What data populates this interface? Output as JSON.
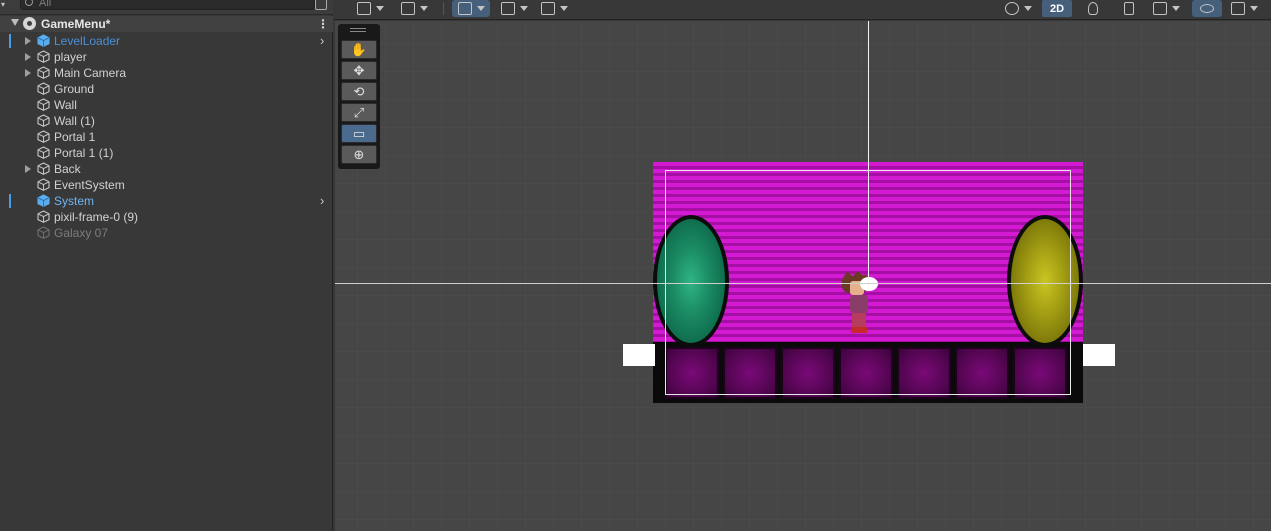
{
  "hierarchy": {
    "search_placeholder": "All",
    "scene_name": "GameMenu*",
    "items": [
      {
        "label": "LevelLoader",
        "color": "#4d8fd6",
        "expandable": true,
        "marker": true,
        "chevron": true,
        "icon": "cube-icon-blue"
      },
      {
        "label": "player",
        "color": "#d2d2d2",
        "expandable": true,
        "marker": false,
        "chevron": false,
        "icon": "cube-icon"
      },
      {
        "label": "Main Camera",
        "color": "#d2d2d2",
        "expandable": true,
        "marker": false,
        "chevron": false,
        "icon": "cube-icon"
      },
      {
        "label": "Ground",
        "color": "#d2d2d2",
        "expandable": false,
        "marker": false,
        "chevron": false,
        "icon": "cube-icon"
      },
      {
        "label": "Wall",
        "color": "#d2d2d2",
        "expandable": false,
        "marker": false,
        "chevron": false,
        "icon": "cube-icon"
      },
      {
        "label": "Wall (1)",
        "color": "#d2d2d2",
        "expandable": false,
        "marker": false,
        "chevron": false,
        "icon": "cube-icon"
      },
      {
        "label": "Portal 1",
        "color": "#d2d2d2",
        "expandable": false,
        "marker": false,
        "chevron": false,
        "icon": "cube-icon"
      },
      {
        "label": "Portal 1 (1)",
        "color": "#d2d2d2",
        "expandable": false,
        "marker": false,
        "chevron": false,
        "icon": "cube-icon"
      },
      {
        "label": "Back",
        "color": "#d2d2d2",
        "expandable": true,
        "marker": false,
        "chevron": false,
        "icon": "cube-icon"
      },
      {
        "label": "EventSystem",
        "color": "#d2d2d2",
        "expandable": false,
        "marker": false,
        "chevron": false,
        "icon": "cube-icon"
      },
      {
        "label": "System",
        "color": "#6fb4f2",
        "expandable": false,
        "marker": true,
        "chevron": true,
        "icon": "cube-icon-blue"
      },
      {
        "label": "pixil-frame-0 (9)",
        "color": "#d2d2d2",
        "expandable": false,
        "marker": false,
        "chevron": false,
        "icon": "cube-icon"
      },
      {
        "label": "Galaxy 07",
        "color": "#7c7c7c",
        "expandable": false,
        "marker": false,
        "chevron": false,
        "icon": "cube-icon-disabled"
      }
    ]
  },
  "scene_toolbar": {
    "mode_2d_label": "2D"
  },
  "tools": [
    {
      "name": "hand-tool",
      "glyph": "✋",
      "selected": false
    },
    {
      "name": "move-tool",
      "glyph": "✥",
      "selected": false
    },
    {
      "name": "rotate-tool",
      "glyph": "⟲",
      "selected": false
    },
    {
      "name": "scale-tool",
      "glyph": "⤢",
      "selected": false
    },
    {
      "name": "rect-tool",
      "glyph": "▭",
      "selected": true
    },
    {
      "name": "transform-tool",
      "glyph": "⊕",
      "selected": false
    }
  ],
  "colors": {
    "accent": "#46607c",
    "selection_blue": "#4a9be8",
    "background_magenta": "#d31ad2",
    "portal_green": "#1c8e66",
    "portal_yellow": "#a6a114"
  }
}
